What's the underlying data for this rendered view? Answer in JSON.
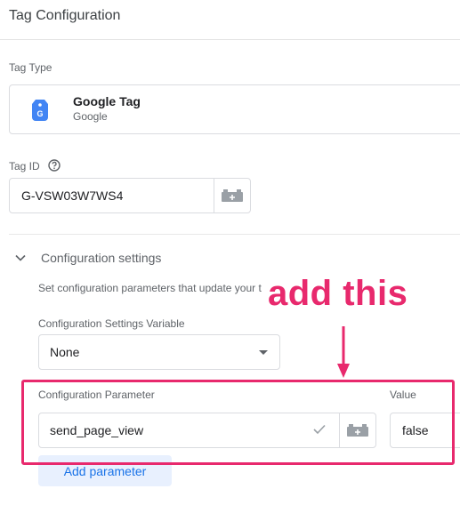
{
  "header": {
    "title": "Tag Configuration"
  },
  "tag_type": {
    "label": "Tag Type",
    "name": "Google Tag",
    "vendor": "Google",
    "icon": "google-tag-icon",
    "icon_color": "#4285f4"
  },
  "tag_id": {
    "label": "Tag ID",
    "help_icon": "help-circle-icon",
    "value": "G-VSW03W7WS4",
    "variable_icon": "variable-picker-icon"
  },
  "config": {
    "title": "Configuration settings",
    "description": "Set configuration parameters that update your t",
    "settings_variable_label": "Configuration Settings Variable",
    "settings_variable_value": "None",
    "param_column_label": "Configuration Parameter",
    "value_column_label": "Value",
    "params": [
      {
        "name": "send_page_view",
        "value": "false"
      }
    ],
    "add_button": "Add parameter"
  },
  "annotation": {
    "text": "add this",
    "color": "#e8296d"
  },
  "colors": {
    "accent": "#1a73e8",
    "highlight": "#e8296d"
  }
}
